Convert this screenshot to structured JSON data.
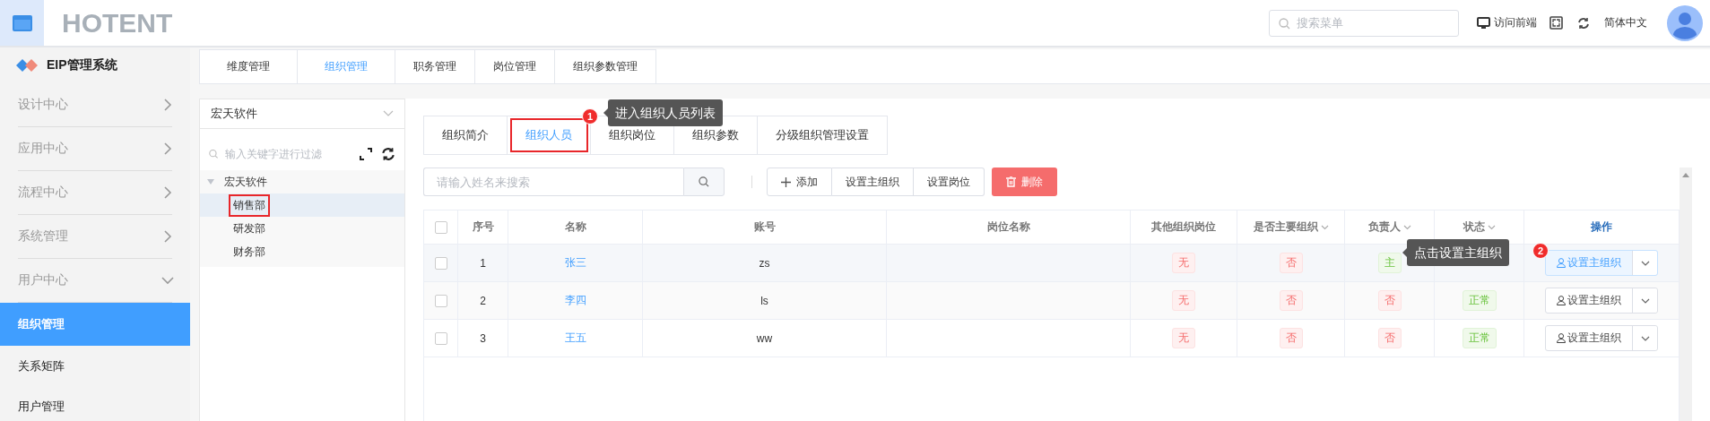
{
  "header": {
    "logo": "HOTENT",
    "search": {
      "placeholder": "搜索菜单"
    },
    "frontend_link": "访问前端",
    "language": "简体中文"
  },
  "sidebar": {
    "title": "EIP管理系统",
    "items": [
      {
        "label": "设计中心",
        "expanded": false
      },
      {
        "label": "应用中心",
        "expanded": false
      },
      {
        "label": "流程中心",
        "expanded": false
      },
      {
        "label": "系统管理",
        "expanded": false
      },
      {
        "label": "用户中心",
        "expanded": true,
        "children": [
          {
            "label": "组织管理",
            "selected": true
          },
          {
            "label": "关系矩阵",
            "selected": false
          },
          {
            "label": "用户管理",
            "selected": false
          }
        ]
      }
    ]
  },
  "tabs": [
    {
      "label": "维度管理",
      "selected": false
    },
    {
      "label": "组织管理",
      "selected": true
    },
    {
      "label": "职务管理",
      "selected": false
    },
    {
      "label": "岗位管理",
      "selected": false
    },
    {
      "label": "组织参数管理",
      "selected": false
    }
  ],
  "tree_panel": {
    "select": {
      "value": "宏天软件"
    },
    "filter": {
      "placeholder": "输入关键字进行过滤"
    },
    "tree": [
      {
        "label": "宏天软件",
        "expanded": true,
        "selected": false,
        "highlighted": false,
        "children": [
          {
            "label": "销售部",
            "selected": true,
            "highlighted": true
          },
          {
            "label": "研发部",
            "selected": false,
            "highlighted": false
          },
          {
            "label": "财务部",
            "selected": false,
            "highlighted": false
          }
        ]
      }
    ]
  },
  "detail_tabs": [
    {
      "label": "组织简介",
      "selected": false,
      "highlighted": false
    },
    {
      "label": "组织人员",
      "selected": true,
      "highlighted": true
    },
    {
      "label": "组织岗位",
      "selected": false,
      "highlighted": false
    },
    {
      "label": "组织参数",
      "selected": false,
      "highlighted": false
    },
    {
      "label": "分级组织管理设置",
      "selected": false,
      "highlighted": false
    }
  ],
  "toolbar": {
    "search": {
      "placeholder": "请输入姓名来搜索"
    },
    "buttons": [
      {
        "label": "添加",
        "kind": "add"
      },
      {
        "label": "设置主组织",
        "kind": "plain"
      },
      {
        "label": "设置岗位",
        "kind": "plain"
      },
      {
        "label": "删除",
        "kind": "delete"
      }
    ]
  },
  "table": {
    "all_checked": false,
    "columns": [
      {
        "label": "序号",
        "sortable": false,
        "kind": "text"
      },
      {
        "label": "名称",
        "sortable": false,
        "kind": "text"
      },
      {
        "label": "账号",
        "sortable": false,
        "kind": "text"
      },
      {
        "label": "岗位名称",
        "sortable": false,
        "kind": "text"
      },
      {
        "label": "其他组织岗位",
        "sortable": false,
        "kind": "text"
      },
      {
        "label": "是否主要组织",
        "sortable": true,
        "kind": "text"
      },
      {
        "label": "负责人",
        "sortable": true,
        "kind": "text"
      },
      {
        "label": "状态",
        "sortable": true,
        "kind": "text"
      },
      {
        "label": "操作",
        "sortable": false,
        "kind": "action"
      }
    ],
    "rows": [
      {
        "checked": false,
        "hovered": true,
        "index": "1",
        "name": "张三",
        "account": "zs",
        "other_positions": {
          "text": "无",
          "kind": "danger"
        },
        "is_main": {
          "text": "否",
          "kind": "danger"
        },
        "leader": {
          "text": "主",
          "kind": "success"
        },
        "action": "设置主组织"
      },
      {
        "checked": false,
        "hovered": false,
        "index": "2",
        "name": "李四",
        "account": "ls",
        "other_positions": {
          "text": "无",
          "kind": "danger"
        },
        "is_main": {
          "text": "否",
          "kind": "danger"
        },
        "leader": {
          "text": "否",
          "kind": "danger"
        },
        "status": {
          "text": "正常",
          "kind": "success"
        },
        "action": "设置主组织"
      },
      {
        "checked": false,
        "hovered": false,
        "index": "3",
        "name": "王五",
        "account": "ww",
        "other_positions": {
          "text": "无",
          "kind": "danger"
        },
        "is_main": {
          "text": "否",
          "kind": "danger"
        },
        "leader": {
          "text": "否",
          "kind": "danger"
        },
        "status": {
          "text": "正常",
          "kind": "success"
        },
        "action": "设置主组织"
      }
    ]
  },
  "annotations": [
    {
      "number": "1",
      "text": "进入组织人员列表"
    },
    {
      "number": "2",
      "text": "点击设置主组织"
    }
  ]
}
